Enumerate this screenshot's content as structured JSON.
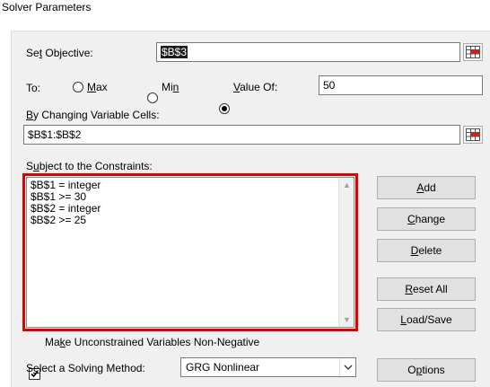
{
  "window": {
    "title": "Solver Parameters"
  },
  "objective": {
    "label_pre": "Se",
    "label_key": "t",
    "label_post": " Objective:",
    "value": "$B$3"
  },
  "to": {
    "label": "To:",
    "max_key": "M",
    "max_rest": "ax",
    "min_pre": "Mi",
    "min_key": "n",
    "valueof_key": "V",
    "valueof_rest": "alue Of:",
    "selected": "Value Of",
    "value": "50"
  },
  "variables": {
    "label_key": "B",
    "label_rest": "y Changing Variable Cells:",
    "value": "$B$1:$B$2"
  },
  "constraints": {
    "label_pre": "S",
    "label_key": "u",
    "label_post": "bject to the Constraints:",
    "items": [
      "$B$1 = integer",
      "$B$1 >= 30",
      "$B$2 = integer",
      "$B$2 >= 25"
    ]
  },
  "buttons": {
    "add_key": "A",
    "add_rest": "dd",
    "change_key": "C",
    "change_rest": "hange",
    "delete_key": "D",
    "delete_rest": "elete",
    "reset_key": "R",
    "reset_rest": "eset All",
    "loadsave_key": "L",
    "loadsave_rest": "oad/Save",
    "options_pre": "O",
    "options_key": "p",
    "options_post": "tions"
  },
  "nonneg": {
    "label_pre": "Ma",
    "label_key": "k",
    "label_post": "e Unconstrained Variables Non-Negative",
    "checked": true
  },
  "method": {
    "label_pre": "S",
    "label_key": "e",
    "label_post": "lect a Solving Method:",
    "value": "GRG Nonlinear"
  },
  "icons": {
    "refedit": "range-select-icon",
    "dropdown": "chevron-down-icon",
    "scroll_up": "scroll-up-icon",
    "scroll_down": "scroll-down-icon",
    "check": "checkmark-icon"
  }
}
